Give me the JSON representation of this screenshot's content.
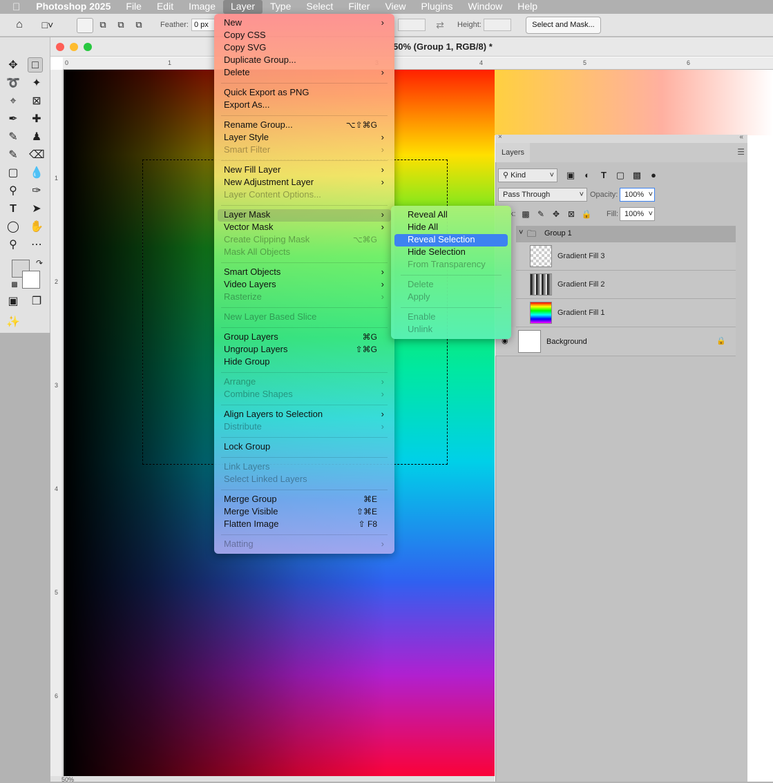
{
  "menubar": {
    "app": "Photoshop 2025",
    "items": [
      "File",
      "Edit",
      "Image",
      "Layer",
      "Type",
      "Select",
      "Filter",
      "View",
      "Plugins",
      "Window",
      "Help"
    ]
  },
  "options": {
    "feather_label": "Feather:",
    "feather_value": "0 px",
    "height_label": "Height:",
    "select_mask": "Select and Mask..."
  },
  "document": {
    "title": "50% (Group 1, RGB/8) *",
    "ruler_h": [
      "0",
      "1",
      "3",
      "4",
      "5",
      "6"
    ],
    "ruler_v": [
      "1",
      "2",
      "3",
      "4",
      "5",
      "6"
    ]
  },
  "layer_menu": {
    "items": [
      {
        "label": "New",
        "arrow": true
      },
      {
        "label": "Copy CSS"
      },
      {
        "label": "Copy SVG"
      },
      {
        "label": "Duplicate Group..."
      },
      {
        "label": "Delete",
        "arrow": true
      },
      {
        "label": "Quick Export as PNG"
      },
      {
        "label": "Export As..."
      },
      {
        "label": "Rename Group...",
        "shortcut": "⌥⇧⌘G"
      },
      {
        "label": "Layer Style",
        "arrow": true
      },
      {
        "label": "Smart Filter",
        "arrow": true,
        "disabled": true
      },
      {
        "label": "New Fill Layer",
        "arrow": true
      },
      {
        "label": "New Adjustment Layer",
        "arrow": true
      },
      {
        "label": "Layer Content Options...",
        "disabled": true
      },
      {
        "label": "Layer Mask",
        "arrow": true,
        "highlight": true
      },
      {
        "label": "Vector Mask",
        "arrow": true
      },
      {
        "label": "Create Clipping Mask",
        "shortcut": "⌥⌘G",
        "disabled": true
      },
      {
        "label": "Mask All Objects",
        "disabled": true
      },
      {
        "label": "Smart Objects",
        "arrow": true
      },
      {
        "label": "Video Layers",
        "arrow": true
      },
      {
        "label": "Rasterize",
        "arrow": true,
        "disabled": true
      },
      {
        "label": "New Layer Based Slice",
        "disabled": true
      },
      {
        "label": "Group Layers",
        "shortcut": "⌘G"
      },
      {
        "label": "Ungroup Layers",
        "shortcut": "⇧⌘G"
      },
      {
        "label": "Hide Group"
      },
      {
        "label": "Arrange",
        "arrow": true,
        "disabled": true
      },
      {
        "label": "Combine Shapes",
        "arrow": true,
        "disabled": true
      },
      {
        "label": "Align Layers to Selection",
        "arrow": true
      },
      {
        "label": "Distribute",
        "arrow": true,
        "disabled": true
      },
      {
        "label": "Lock Group"
      },
      {
        "label": "Link Layers",
        "disabled": true
      },
      {
        "label": "Select Linked Layers",
        "disabled": true
      },
      {
        "label": "Merge Group",
        "shortcut": "⌘E"
      },
      {
        "label": "Merge Visible",
        "shortcut": "⇧⌘E"
      },
      {
        "label": "Flatten Image",
        "shortcut": "⇧ F8"
      },
      {
        "label": "Matting",
        "arrow": true,
        "disabled": true
      }
    ]
  },
  "mask_submenu": {
    "items": [
      {
        "label": "Reveal All"
      },
      {
        "label": "Hide All"
      },
      {
        "label": "Reveal Selection",
        "highlight": true
      },
      {
        "label": "Hide Selection"
      },
      {
        "label": "From Transparency",
        "disabled": true
      },
      {
        "label": "Delete",
        "disabled": true
      },
      {
        "label": "Apply",
        "disabled": true
      },
      {
        "label": "Enable",
        "disabled": true
      },
      {
        "label": "Unlink",
        "disabled": true
      }
    ]
  },
  "layers_panel": {
    "tab": "Layers",
    "kind": "Kind",
    "blend": "Pass Through",
    "opacity_label": "Opacity:",
    "opacity": "100%",
    "lock_label": "k:",
    "fill_label": "Fill:",
    "fill": "100%",
    "layers": [
      {
        "name": "Group 1"
      },
      {
        "name": "Gradient Fill 3"
      },
      {
        "name": "Gradient Fill 2"
      },
      {
        "name": "Gradient Fill 1"
      },
      {
        "name": "Background"
      }
    ]
  },
  "status": {
    "zoom": "50%"
  }
}
